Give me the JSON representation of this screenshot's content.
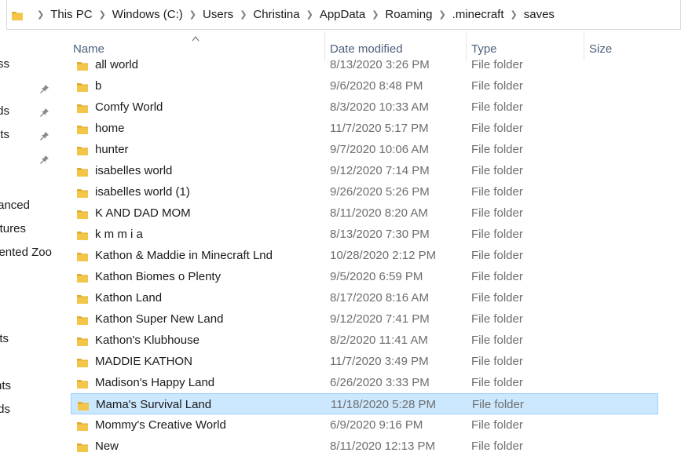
{
  "breadcrumb": [
    "This PC",
    "Windows (C:)",
    "Users",
    "Christina",
    "AppData",
    "Roaming",
    ".minecraft",
    "saves"
  ],
  "nav": {
    "items": [
      "ss",
      "ds",
      "nts",
      "anced",
      "ctures",
      "ented Zoo",
      "ts",
      "nts",
      "ds"
    ]
  },
  "columns": {
    "name": "Name",
    "date": "Date modified",
    "type": "Type",
    "size": "Size"
  },
  "rows": [
    {
      "name": "all world",
      "date": "8/13/2020 3:26 PM",
      "type": "File folder"
    },
    {
      "name": "b",
      "date": "9/6/2020 8:48 PM",
      "type": "File folder"
    },
    {
      "name": "Comfy World",
      "date": "8/3/2020 10:33 AM",
      "type": "File folder"
    },
    {
      "name": "home",
      "date": "11/7/2020 5:17 PM",
      "type": "File folder"
    },
    {
      "name": "hunter",
      "date": "9/7/2020 10:06 AM",
      "type": "File folder"
    },
    {
      "name": "isabelles world",
      "date": "9/12/2020 7:14 PM",
      "type": "File folder"
    },
    {
      "name": "isabelles world (1)",
      "date": "9/26/2020 5:26 PM",
      "type": "File folder"
    },
    {
      "name": "K AND DAD MOM",
      "date": "8/11/2020 8:20 AM",
      "type": "File folder"
    },
    {
      "name": "k m m i a",
      "date": "8/13/2020 7:30 PM",
      "type": "File folder"
    },
    {
      "name": "Kathon & Maddie in Minecraft Lnd",
      "date": "10/28/2020 2:12 PM",
      "type": "File folder"
    },
    {
      "name": "Kathon Biomes o Plenty",
      "date": "9/5/2020 6:59 PM",
      "type": "File folder"
    },
    {
      "name": "Kathon Land",
      "date": "8/17/2020 8:16 AM",
      "type": "File folder"
    },
    {
      "name": "Kathon Super New Land",
      "date": "9/12/2020 7:41 PM",
      "type": "File folder"
    },
    {
      "name": "Kathon's Klubhouse",
      "date": "8/2/2020 11:41 AM",
      "type": "File folder"
    },
    {
      "name": "MADDIE KATHON",
      "date": "11/7/2020 3:49 PM",
      "type": "File folder"
    },
    {
      "name": "Madison's Happy Land",
      "date": "6/26/2020 3:33 PM",
      "type": "File folder"
    },
    {
      "name": "Mama's Survival Land",
      "date": "11/18/2020 5:28 PM",
      "type": "File folder",
      "selected": true
    },
    {
      "name": "Mommy's Creative World",
      "date": "6/9/2020 9:16 PM",
      "type": "File folder"
    },
    {
      "name": "New",
      "date": "8/11/2020 12:13 PM",
      "type": "File folder"
    }
  ],
  "colors": {
    "folder": "#f3c64a",
    "folder_dark": "#e0a92a",
    "selected_bg": "#cce8ff",
    "selected_border": "#99d1ff",
    "header_text": "#4c607a"
  }
}
